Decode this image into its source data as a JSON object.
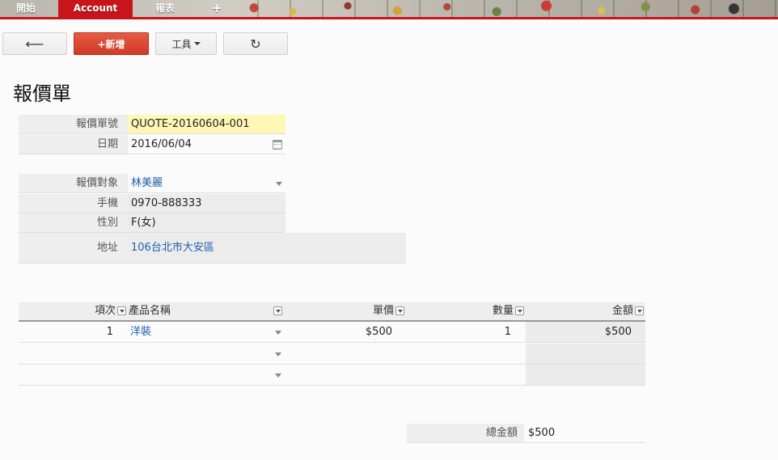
{
  "nav": {
    "start": "開始",
    "account": "Account",
    "report": "報表",
    "add": "+"
  },
  "toolbar": {
    "back": "⟵",
    "new": "+新增",
    "tools": "工具",
    "refresh": "↻"
  },
  "page_title": "報價單",
  "form": {
    "quote_no_label": "報價單號",
    "quote_no": "QUOTE-20160604-001",
    "date_label": "日期",
    "date": "2016/06/04",
    "target_label": "報價對象",
    "target": "林美麗",
    "mobile_label": "手機",
    "mobile": "0970-888333",
    "gender_label": "性別",
    "gender": "F(女)",
    "address_label": "地址",
    "address": "106台北市大安區"
  },
  "table": {
    "headers": {
      "item": "項次",
      "product": "產品名稱",
      "unit_price": "單價",
      "qty": "數量",
      "amount": "金額"
    },
    "rows": [
      {
        "item": "1",
        "product": "洋裝",
        "unit_price": "$500",
        "qty": "1",
        "amount": "$500"
      },
      {
        "item": "",
        "product": "",
        "unit_price": "",
        "qty": "",
        "amount": ""
      },
      {
        "item": "",
        "product": "",
        "unit_price": "",
        "qty": "",
        "amount": ""
      }
    ]
  },
  "total": {
    "label": "總金額",
    "value": "$500"
  }
}
